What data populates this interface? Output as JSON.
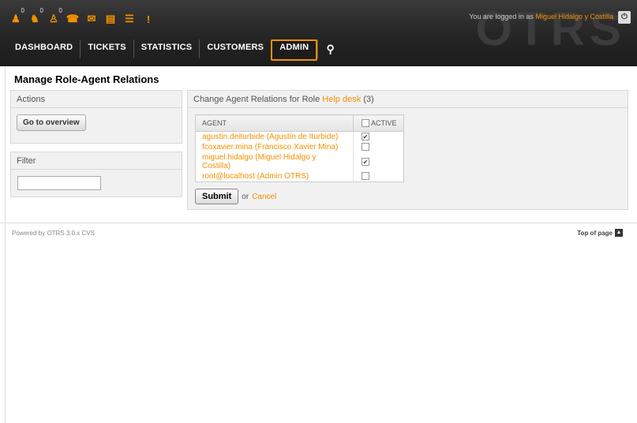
{
  "brand": {
    "watermark": "OTRS",
    "accent": "#f29100"
  },
  "toolbar": [
    {
      "icon": "locked-tickets-icon",
      "glyph": "♟",
      "badge": "0"
    },
    {
      "icon": "watched-tickets-icon",
      "glyph": "♞",
      "badge": "0"
    },
    {
      "icon": "responsible-tickets-icon",
      "glyph": "♙",
      "badge": "0"
    },
    {
      "icon": "phone-ticket-icon",
      "glyph": "☎",
      "badge": ""
    },
    {
      "icon": "email-ticket-icon",
      "glyph": "✉",
      "badge": ""
    },
    {
      "icon": "queue-view-icon",
      "glyph": "▤",
      "badge": ""
    },
    {
      "icon": "status-view-icon",
      "glyph": "☰",
      "badge": ""
    },
    {
      "icon": "escalation-view-icon",
      "glyph": "!",
      "badge": ""
    }
  ],
  "user": {
    "prefix": "You are logged in as",
    "name": "Miguel Hidalgo y Costilla"
  },
  "nav": {
    "dashboard": "DASHBOARD",
    "tickets": "TICKETS",
    "statistics": "STATISTICS",
    "customers": "CUSTOMERS",
    "admin": "ADMIN",
    "search_glyph": "⚲"
  },
  "page": {
    "title": "Manage Role-Agent Relations"
  },
  "actions": {
    "header": "Actions",
    "overview_button": "Go to overview"
  },
  "filter": {
    "header": "Filter",
    "value": ""
  },
  "relations": {
    "header_prefix": "Change Agent Relations for Role",
    "role": "Help desk",
    "count": "(3)",
    "col_agent": "AGENT",
    "col_active": "ACTIVE",
    "rows": [
      {
        "agent": "agustin.deiturbide (Agustín de Iturbide)",
        "active": true
      },
      {
        "agent": "fcoxavier.mina (Francisco Xavier Mina)",
        "active": false
      },
      {
        "agent": "miguel.hidalgo (Miguel Hidalgo y Costilla)",
        "active": true
      },
      {
        "agent": "root@localhost (Admin OTRS)",
        "active": false
      }
    ],
    "submit_label": "Submit",
    "or_text": "or",
    "cancel_label": "Cancel"
  },
  "footer": {
    "powered_by": "Powered by OTRS 3.0.x CVS",
    "top_of_page": "Top of page"
  }
}
